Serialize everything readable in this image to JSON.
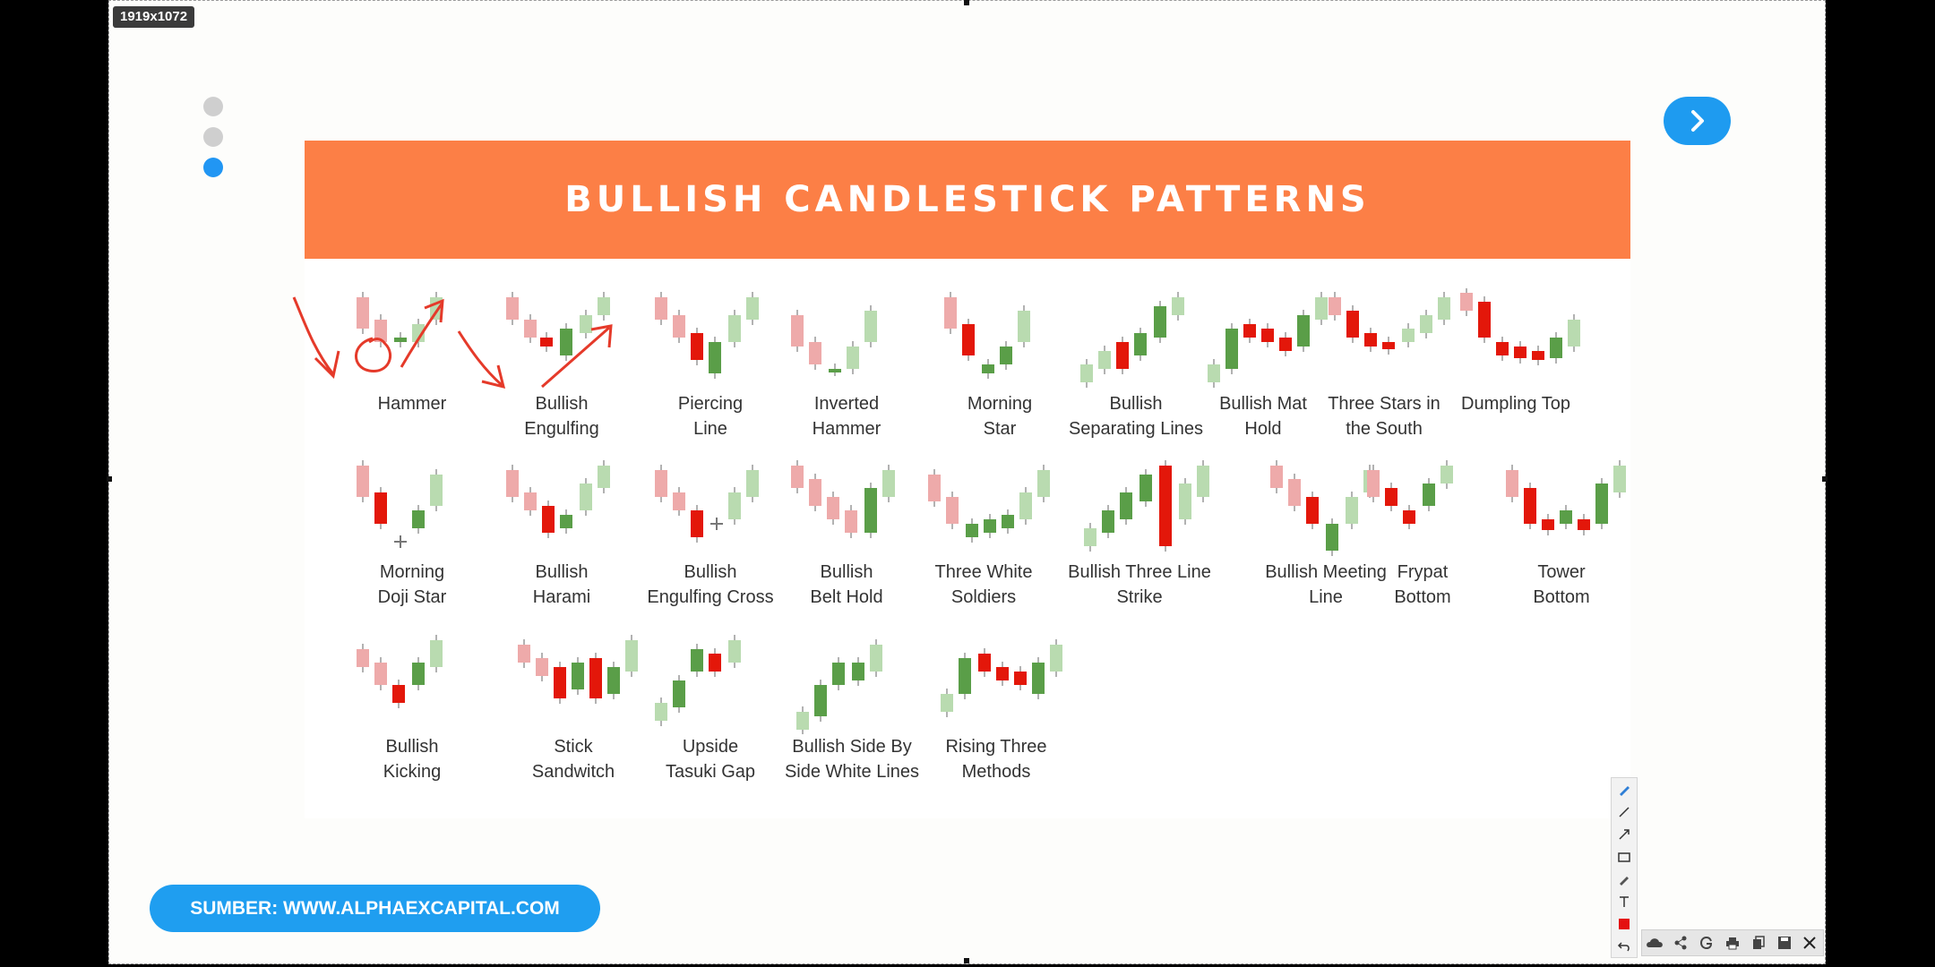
{
  "window": {
    "dimensions_badge": "1919x1072"
  },
  "nav": {
    "slide_dots": [
      "slide-1",
      "slide-2",
      "slide-3"
    ],
    "active_dot": 3,
    "next_icon": "chevron-right-icon"
  },
  "slide": {
    "title": "BULLISH CANDLESTICK PATTERNS",
    "patterns": [
      "Hammer",
      "Bullish\nEngulfing",
      "Piercing\nLine",
      "Inverted\nHammer",
      "Morning\nStar",
      "Bullish\nSeparating Lines",
      "Bullish Mat\nHold",
      "Three Stars in\nthe South",
      "Dumpling Top",
      "Morning\nDoji Star",
      "Bullish\nHarami",
      "Bullish\nEngulfing Cross",
      "Bullish\nBelt Hold",
      "Three White\nSoldiers",
      "Bullish Three Line\nStrike",
      "Bullish Meeting\nLine",
      "Frypat\nBottom",
      "Tower\nBottom",
      "Bullish\nKicking",
      "Stick\nSandwitch",
      "Upside\nTasuki Gap",
      "Bullish Side By\nSide White Lines",
      "Rising Three\nMethods"
    ]
  },
  "footer": {
    "source_label": "SUMBER: WWW.ALPHAEXCAPITAL.COM"
  },
  "tools": {
    "vertical": [
      "pen-icon",
      "line-icon",
      "arrow-icon",
      "rectangle-icon",
      "highlighter-icon",
      "text-icon",
      "color-swatch-icon",
      "undo-icon"
    ],
    "horizontal": [
      "cloud-upload-icon",
      "share-icon",
      "google-icon",
      "print-icon",
      "copy-icon",
      "save-icon",
      "close-icon"
    ]
  },
  "colors": {
    "banner": "#fc7f46",
    "accent_blue": "#1e9bf0",
    "bear": "#e3170a",
    "bear_faded": "#eeaaaa",
    "bull": "#5a9e48",
    "bull_faded": "#b9dbb0",
    "annotation_ink": "#e53a2a"
  }
}
